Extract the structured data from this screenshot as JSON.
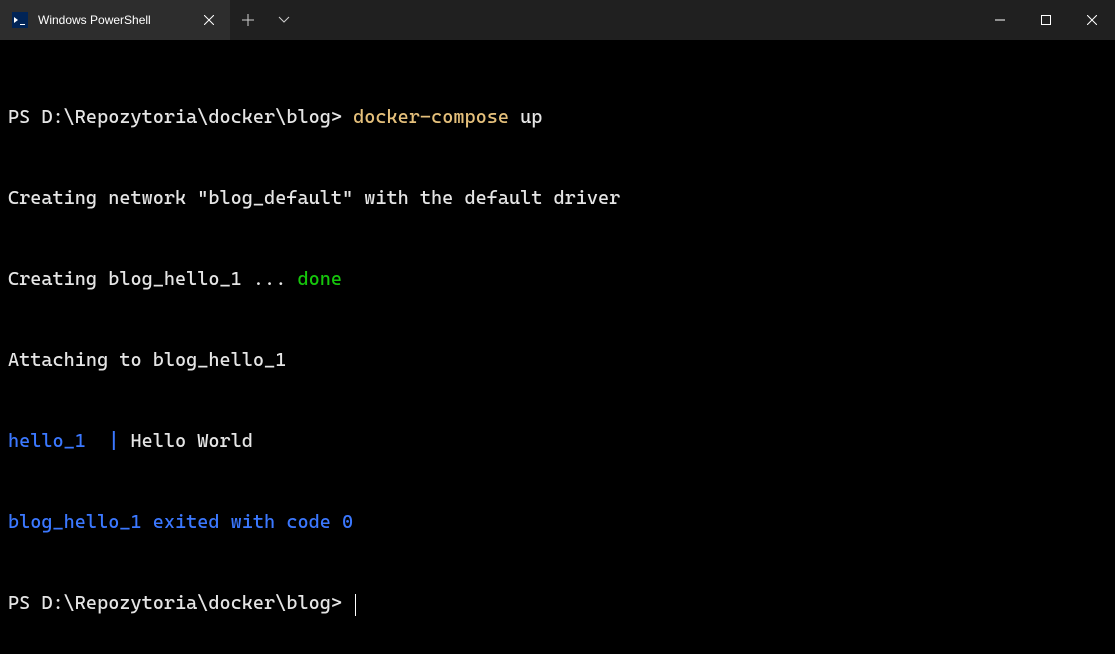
{
  "titlebar": {
    "tab_title": "Windows PowerShell",
    "new_tab_label": "+",
    "dropdown_label": "⌄"
  },
  "terminal": {
    "lines": [
      {
        "prompt": "PS D:\\Repozytoria\\docker\\blog> ",
        "cmd_part1": "docker-compose",
        "cmd_part2": " up"
      },
      {
        "text": "Creating network \"blog_default\" with the default driver"
      },
      {
        "pre": "Creating blog_hello_1 ... ",
        "status": "done"
      },
      {
        "text": "Attaching to blog_hello_1"
      },
      {
        "service": "hello_1  |",
        "output": " Hello World"
      },
      {
        "exit": "blog_hello_1 exited with code 0"
      },
      {
        "prompt": "PS D:\\Repozytoria\\docker\\blog> "
      }
    ]
  }
}
